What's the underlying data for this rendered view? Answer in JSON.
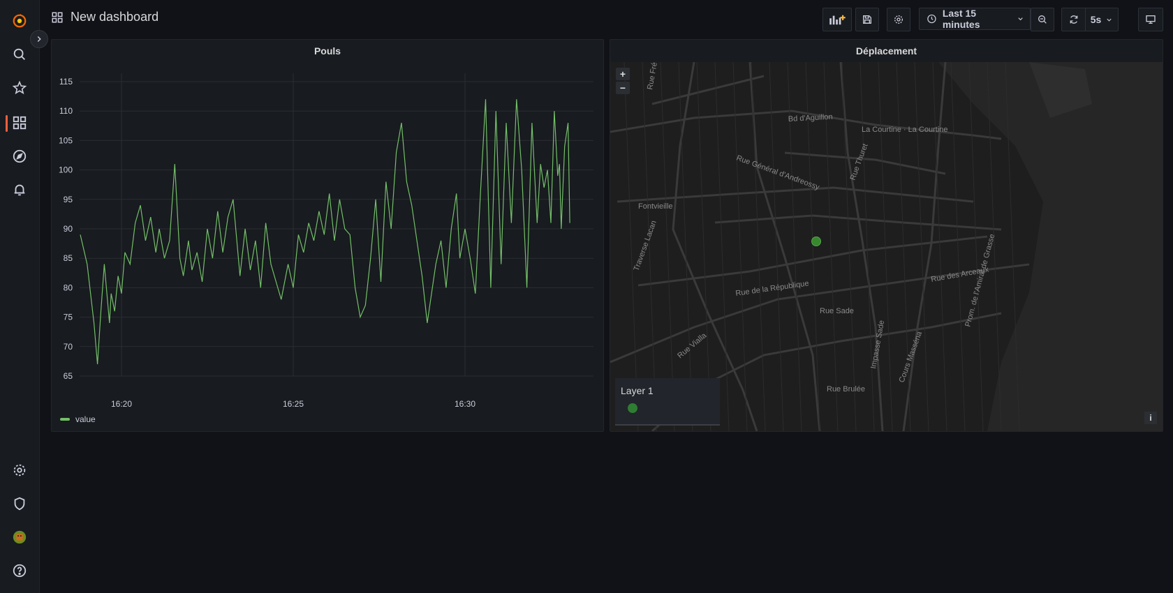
{
  "dashboard": {
    "title": "New dashboard"
  },
  "toolbar": {
    "time_range_label": "Last 15 minutes",
    "refresh_interval_label": "5s"
  },
  "sidebar": {
    "items": [
      {
        "name": "grafana-logo-icon"
      },
      {
        "name": "search-icon"
      },
      {
        "name": "starred-icon"
      },
      {
        "name": "dashboards-icon"
      },
      {
        "name": "explore-icon"
      },
      {
        "name": "alerting-icon"
      },
      {
        "name": "configuration-icon"
      },
      {
        "name": "server-admin-icon"
      },
      {
        "name": "user-avatar"
      },
      {
        "name": "help-icon"
      }
    ],
    "active_item": "dashboards-icon"
  },
  "panels": {
    "pouls": {
      "title": "Pouls",
      "legend_label": "value"
    },
    "deplacement": {
      "title": "Déplacement",
      "layer_name": "Layer 1",
      "zoom_in": "+",
      "zoom_out": "−",
      "info": "i"
    }
  },
  "colors": {
    "series": "#73bf69",
    "accent": "#f55f3e",
    "map_marker": "#37872d"
  },
  "map": {
    "street_labels": [
      "Bd d'Aguillon",
      "La Courtine · La Courtine",
      "Rue Général d'Andreossy",
      "Rue Thuret",
      "Rue de la République",
      "Rue Sade",
      "Rue Vialla",
      "Rue des Arceaux",
      "Rue Brulée",
      "Traverse Lacan",
      "Fontvieille",
      "Prom. de l'Amiral de Grasse",
      "Impasse Sade",
      "Cours Masséna",
      "Rue Frédéric Mistral"
    ]
  },
  "chart_data": {
    "type": "line",
    "title": "Pouls",
    "xlabel": "",
    "ylabel": "",
    "x_ticks": [
      "16:20",
      "16:25",
      "16:30"
    ],
    "ylim": [
      65,
      115
    ],
    "y_ticks": [
      65,
      70,
      75,
      80,
      85,
      90,
      95,
      100,
      105,
      110,
      115
    ],
    "grid": true,
    "legend_position": "bottom-left",
    "series": [
      {
        "name": "value",
        "x_minutes_from_1620": [
          -1.2,
          -1.0,
          -0.8,
          -0.7,
          -0.6,
          -0.5,
          -0.35,
          -0.3,
          -0.2,
          -0.1,
          0.0,
          0.1,
          0.25,
          0.4,
          0.55,
          0.7,
          0.85,
          1.0,
          1.1,
          1.25,
          1.4,
          1.55,
          1.7,
          1.8,
          1.95,
          2.05,
          2.2,
          2.35,
          2.5,
          2.65,
          2.8,
          2.95,
          3.1,
          3.25,
          3.45,
          3.6,
          3.75,
          3.9,
          4.05,
          4.2,
          4.35,
          4.5,
          4.65,
          4.85,
          5.0,
          5.15,
          5.3,
          5.45,
          5.6,
          5.75,
          5.9,
          6.05,
          6.2,
          6.35,
          6.5,
          6.65,
          6.8,
          6.95,
          7.1,
          7.25,
          7.4,
          7.55,
          7.7,
          7.85,
          8.0,
          8.15,
          8.3,
          8.45,
          8.6,
          8.75,
          8.9,
          9.0,
          9.15,
          9.3,
          9.45,
          9.6,
          9.75,
          9.85,
          10.0,
          10.15,
          10.3,
          10.45,
          10.6,
          10.75,
          10.9,
          11.05,
          11.2,
          11.35,
          11.5,
          11.65,
          11.8,
          11.95,
          12.1,
          12.2,
          12.3,
          12.4,
          12.5,
          12.6,
          12.7,
          12.75,
          12.8,
          12.9,
          13.0,
          13.05
        ],
        "values": [
          89,
          84,
          74,
          67,
          76,
          84,
          74,
          79,
          76,
          82,
          79,
          86,
          84,
          91,
          94,
          88,
          92,
          86,
          90,
          85,
          88,
          101,
          85,
          82,
          88,
          83,
          86,
          81,
          90,
          85,
          93,
          86,
          92,
          95,
          82,
          90,
          83,
          88,
          80,
          91,
          84,
          81,
          78,
          84,
          80,
          89,
          86,
          91,
          88,
          93,
          89,
          96,
          88,
          95,
          90,
          89,
          80,
          75,
          77,
          85,
          95,
          81,
          98,
          90,
          103,
          108,
          98,
          94,
          88,
          82,
          74,
          78,
          84,
          88,
          80,
          90,
          96,
          85,
          90,
          85,
          79,
          96,
          112,
          80,
          110,
          84,
          108,
          91,
          112,
          100,
          80,
          108,
          91,
          101,
          97,
          100,
          91,
          110,
          99,
          101,
          90,
          104,
          108,
          91
        ]
      }
    ]
  }
}
